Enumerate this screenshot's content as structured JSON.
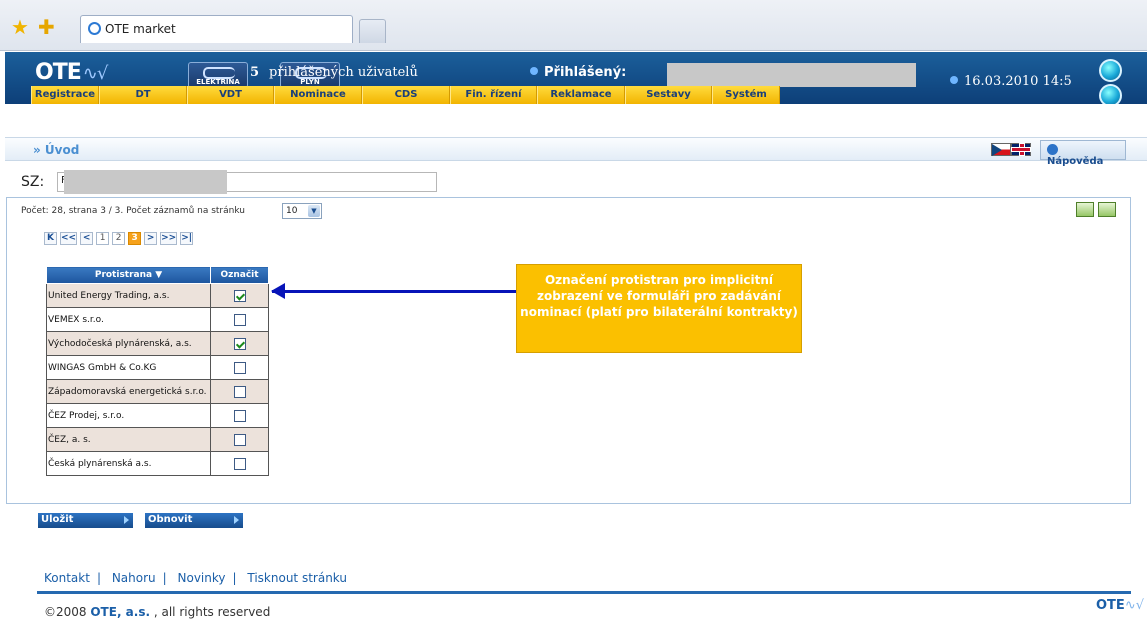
{
  "browser": {
    "tab_title": "OTE market"
  },
  "header": {
    "logo": "OTE",
    "logo_wave": "∿√",
    "commodity_buttons": [
      "ELEKTŘINA",
      "PLYN"
    ],
    "online_count": "5",
    "online_label": "přihlášených uživatelů",
    "logged_label": "Přihlášený:",
    "date": "16.03.2010 14:5"
  },
  "menu": [
    "Registrace",
    "DT",
    "VDT",
    "Nominace",
    "CDS",
    "Fin. řízení",
    "Reklamace",
    "Sestavy",
    "Systém"
  ],
  "breadcrumb": {
    "label": "» Úvod",
    "help_label": "Nápověda"
  },
  "sz": {
    "label": "SZ:",
    "value": "F"
  },
  "listing": {
    "count_text": "Počet: 28, strana 3 / 3.  Počet záznamů na stránku",
    "page_size": "10",
    "pager_nav": [
      "K",
      "<<",
      "<",
      ">",
      ">>",
      ">|"
    ],
    "pages": [
      "1",
      "2",
      "3"
    ],
    "current_page": "3"
  },
  "table": {
    "headers": [
      "Protistrana ▼",
      "Označit"
    ],
    "rows": [
      {
        "name": "United Energy Trading, a.s.",
        "checked": true
      },
      {
        "name": "VEMEX s.r.o.",
        "checked": false
      },
      {
        "name": "Východočeská plynárenská, a.s.",
        "checked": true
      },
      {
        "name": "WINGAS GmbH & Co.KG",
        "checked": false
      },
      {
        "name": "Západomoravská energetická s.r.o.",
        "checked": false
      },
      {
        "name": "ČEZ Prodej, s.r.o.",
        "checked": false
      },
      {
        "name": "ČEZ, a. s.",
        "checked": false
      },
      {
        "name": "Česká plynárenská a.s.",
        "checked": false
      }
    ]
  },
  "callout": {
    "text": "Označení protistran pro implicitní zobrazení ve formuláři pro zadávání nominací (platí pro bilaterální kontrakty)"
  },
  "actions": {
    "save": "Uložit",
    "refresh": "Obnovit"
  },
  "footer": {
    "links": [
      "Kontakt",
      "Nahoru",
      "Novinky",
      "Tisknout stránku"
    ],
    "copyright_pre": "©2008 ",
    "copyright_org": "OTE, a.s.",
    "copyright_post": " , all rights reserved",
    "logo": "OTE",
    "logo_wave": "∿√"
  },
  "colors": {
    "accent": "#1b5fa8",
    "menu": "#f2b400",
    "callout": "#fbc000",
    "arrow": "#0714b8"
  }
}
